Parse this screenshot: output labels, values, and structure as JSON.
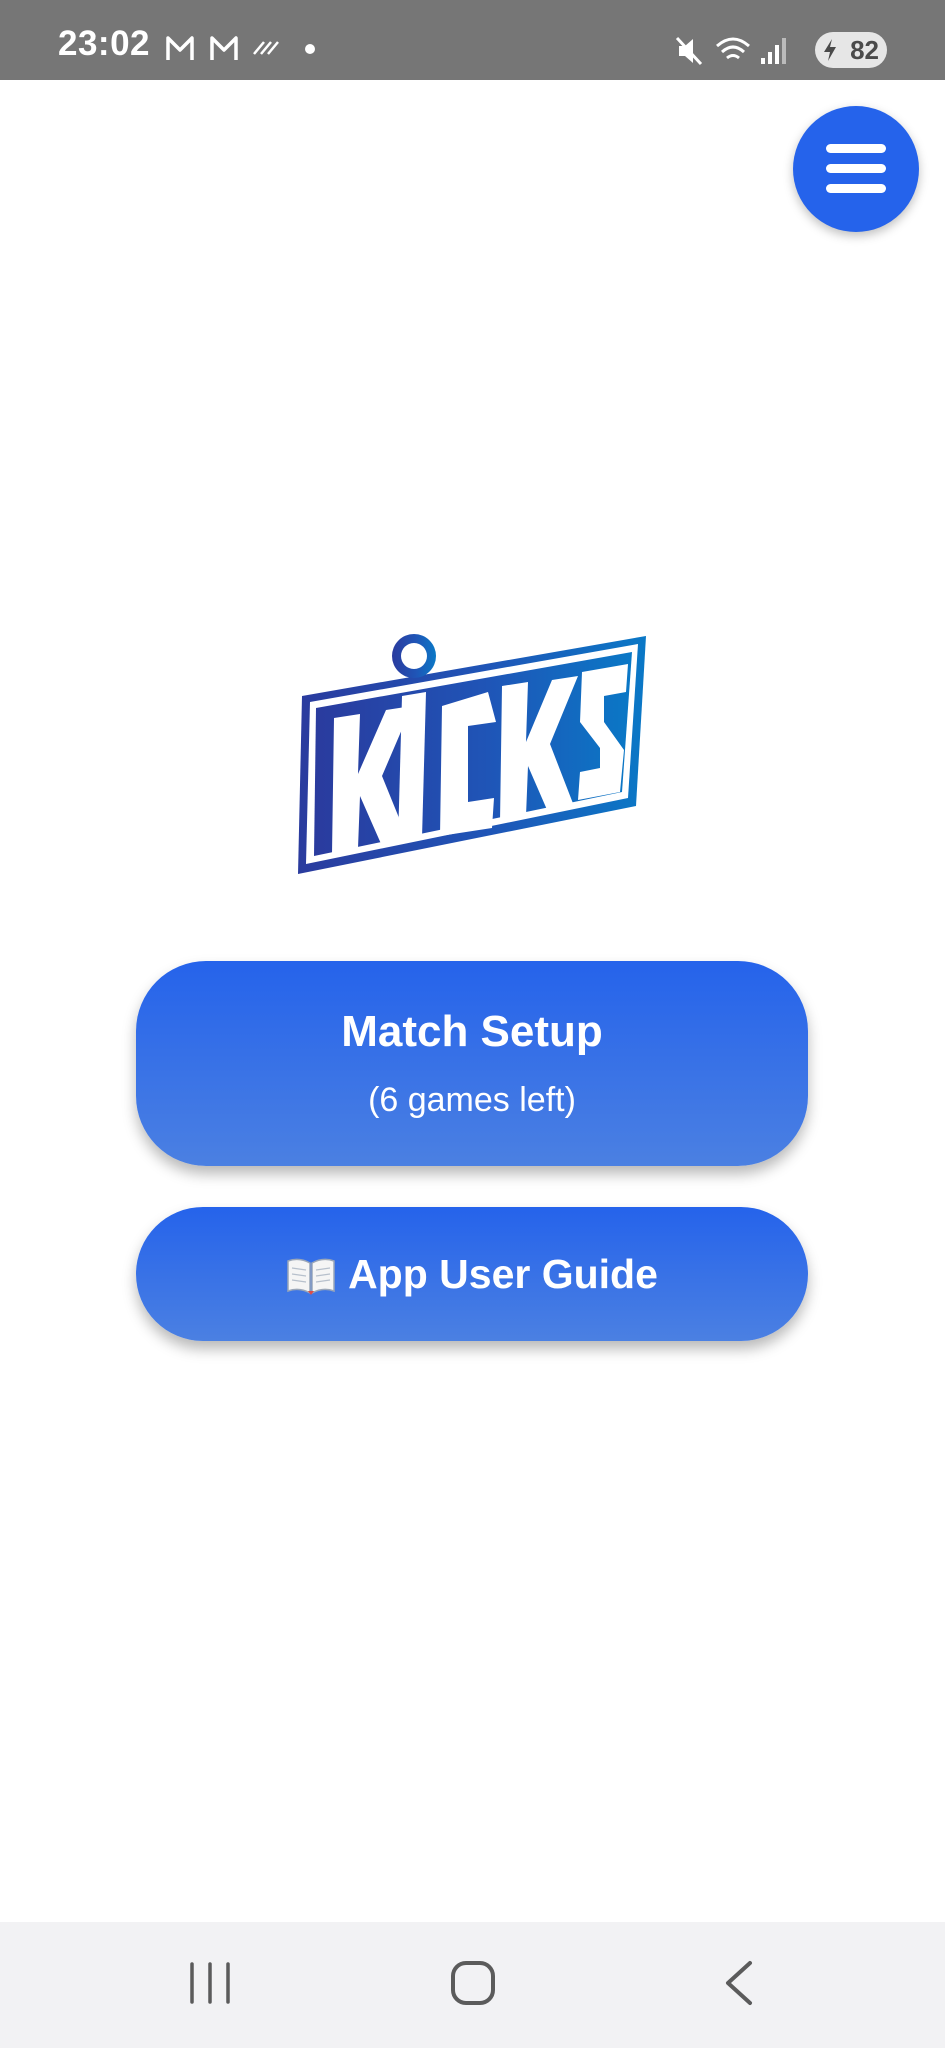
{
  "status_bar": {
    "time": "23:02",
    "battery": "82",
    "left_icons": [
      "gmail-icon",
      "gmail-icon",
      "nfc-icon",
      "dot-icon"
    ],
    "right_icons": [
      "mute-icon",
      "wifi-icon",
      "signal-icon",
      "battery-icon"
    ]
  },
  "menu": {
    "icon": "hamburger-menu-icon"
  },
  "logo": {
    "text": "KICKS"
  },
  "buttons": {
    "match_setup": {
      "title": "Match Setup",
      "subtitle": "(6 games left)"
    },
    "user_guide": {
      "icon": "open-book-icon",
      "label": "App User Guide"
    }
  },
  "nav": {
    "items": [
      "recent-apps-icon",
      "home-icon",
      "back-icon"
    ]
  },
  "colors": {
    "accent": "#2563eb",
    "status_bar": "#767676",
    "nav_bar": "#f2f2f4"
  }
}
